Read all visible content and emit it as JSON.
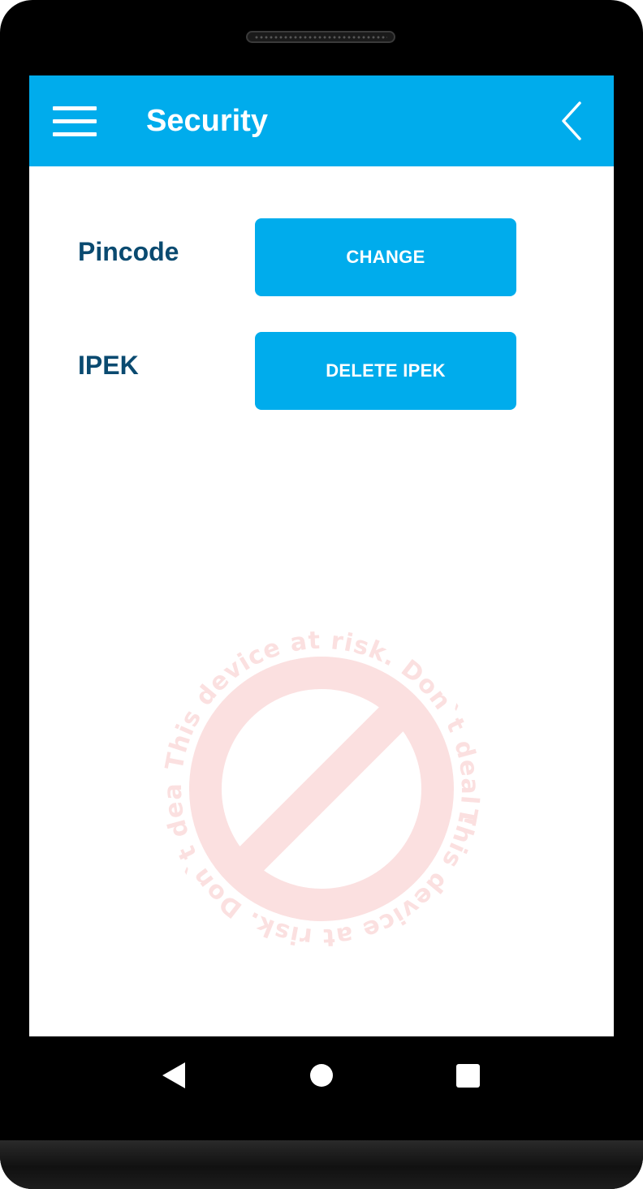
{
  "appbar": {
    "title": "Security",
    "menu_icon": "hamburger-menu-icon",
    "back_icon": "chevron-left-icon",
    "color": "#00acec"
  },
  "rows": [
    {
      "label": "Pincode",
      "button_label": "CHANGE"
    },
    {
      "label": "IPEK",
      "button_label": "DELETE IPEK"
    }
  ],
  "watermark": {
    "text": "This device at risk. Don`t deal !",
    "icon": "prohibited-icon",
    "color": "#fbe0e0"
  },
  "navbar": {
    "back_icon": "triangle-back-icon",
    "home_icon": "circle-home-icon",
    "recents_icon": "square-recents-icon"
  },
  "colors": {
    "accent": "#00acec",
    "label_text": "#0a4a70",
    "button_text": "#ffffff"
  }
}
